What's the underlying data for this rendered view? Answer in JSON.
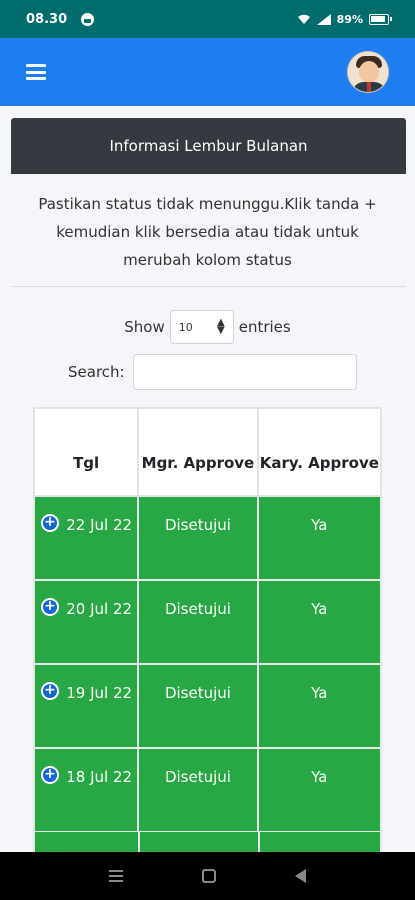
{
  "status_bar": {
    "time": "08.30",
    "battery": "89%"
  },
  "card": {
    "title": "Informasi Lembur Bulanan"
  },
  "info_text": "Pastikan status tidak menunggu.Klik tanda + kemudian klik bersedia atau tidak untuk merubah kolom status",
  "table_controls": {
    "show_label": "Show",
    "entries_value": "10",
    "entries_label": "entries",
    "search_label": "Search:"
  },
  "table": {
    "headers": [
      "Tgl",
      "Mgr. Approve",
      "Kary. Approve"
    ],
    "rows": [
      {
        "tgl": "22 Jul 22",
        "mgr": "Disetujui",
        "kary": "Ya"
      },
      {
        "tgl": "20 Jul 22",
        "mgr": "Disetujui",
        "kary": "Ya"
      },
      {
        "tgl": "19 Jul 22",
        "mgr": "Disetujui",
        "kary": "Ya"
      },
      {
        "tgl": "18 Jul 22",
        "mgr": "Disetujui",
        "kary": "Ya"
      }
    ]
  },
  "colors": {
    "navbar": "#1e7df1",
    "status_bar": "#006d6d",
    "row_green": "#28a745",
    "card_header": "#343a40"
  },
  "icons": [
    "hamburger-icon",
    "avatar",
    "plus-circle-icon",
    "wifi-icon",
    "signal-icon",
    "battery-icon",
    "headphone-icon"
  ]
}
